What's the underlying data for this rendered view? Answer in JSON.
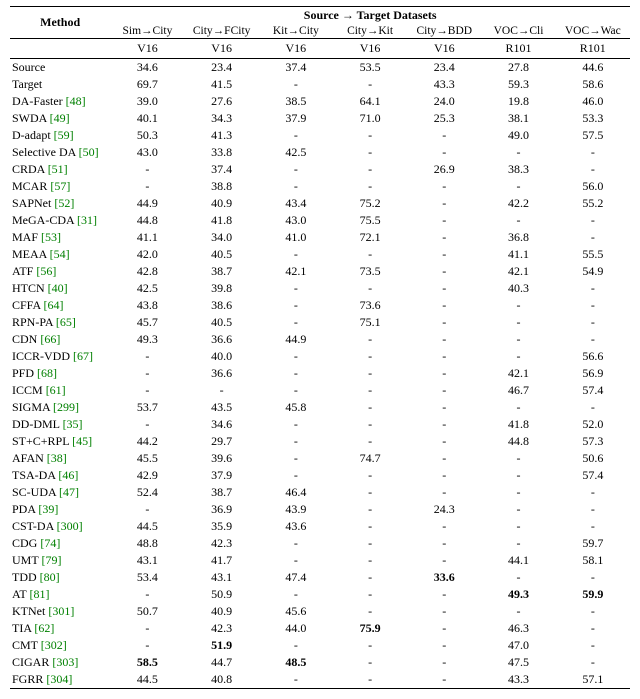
{
  "chart_data": {
    "type": "table",
    "title": "Source → Target Datasets",
    "method_header": "Method",
    "columns": [
      "Sim→City",
      "City→FCity",
      "Kit→City",
      "City→Kit",
      "City→BDD",
      "VOC→Cli",
      "VOC→Wac"
    ],
    "arch": [
      "V16",
      "V16",
      "V16",
      "V16",
      "V16",
      "R101",
      "R101"
    ],
    "rows": [
      {
        "name": "Source",
        "vals": [
          "34.6",
          "23.4",
          "37.4",
          "53.5",
          "23.4",
          "27.8",
          "44.6"
        ]
      },
      {
        "name": "Target",
        "vals": [
          "69.7",
          "41.5",
          "-",
          "-",
          "43.3",
          "59.3",
          "58.6"
        ]
      },
      {
        "name": "DA-Faster",
        "cite": "[48]",
        "vals": [
          "39.0",
          "27.6",
          "38.5",
          "64.1",
          "24.0",
          "19.8",
          "46.0"
        ]
      },
      {
        "name": "SWDA",
        "cite": "[49]",
        "vals": [
          "40.1",
          "34.3",
          "37.9",
          "71.0",
          "25.3",
          "38.1",
          "53.3"
        ]
      },
      {
        "name": "D-adapt",
        "cite": "[59]",
        "vals": [
          "50.3",
          "41.3",
          "-",
          "-",
          "-",
          "49.0",
          "57.5"
        ]
      },
      {
        "name": "Selective DA",
        "cite": "[50]",
        "vals": [
          "43.0",
          "33.8",
          "42.5",
          "-",
          "-",
          "-",
          "-"
        ]
      },
      {
        "name": "CRDA",
        "cite": "[51]",
        "vals": [
          "-",
          "37.4",
          "-",
          "-",
          "26.9",
          "38.3",
          "-"
        ]
      },
      {
        "name": "MCAR",
        "cite": "[57]",
        "vals": [
          "-",
          "38.8",
          "-",
          "-",
          "-",
          "-",
          "56.0"
        ]
      },
      {
        "name": "SAPNet",
        "cite": "[52]",
        "vals": [
          "44.9",
          "40.9",
          "43.4",
          "75.2",
          "-",
          "42.2",
          "55.2"
        ]
      },
      {
        "name": "MeGA-CDA",
        "cite": "[31]",
        "vals": [
          "44.8",
          "41.8",
          "43.0",
          "75.5",
          "-",
          "-",
          "-"
        ]
      },
      {
        "name": "MAF",
        "cite": "[53]",
        "vals": [
          "41.1",
          "34.0",
          "41.0",
          "72.1",
          "-",
          "36.8",
          "-"
        ]
      },
      {
        "name": "MEAA",
        "cite": "[54]",
        "vals": [
          "42.0",
          "40.5",
          "-",
          "-",
          "-",
          "41.1",
          "55.5"
        ]
      },
      {
        "name": "ATF",
        "cite": "[56]",
        "vals": [
          "42.8",
          "38.7",
          "42.1",
          "73.5",
          "-",
          "42.1",
          "54.9"
        ]
      },
      {
        "name": "HTCN",
        "cite": "[40]",
        "vals": [
          "42.5",
          "39.8",
          "-",
          "-",
          "-",
          "40.3",
          "-"
        ]
      },
      {
        "name": "CFFA",
        "cite": "[64]",
        "vals": [
          "43.8",
          "38.6",
          "-",
          "73.6",
          "-",
          "-",
          "-"
        ]
      },
      {
        "name": "RPN-PA",
        "cite": "[65]",
        "vals": [
          "45.7",
          "40.5",
          "-",
          "75.1",
          "-",
          "-",
          "-"
        ]
      },
      {
        "name": "CDN",
        "cite": "[66]",
        "vals": [
          "49.3",
          "36.6",
          "44.9",
          "-",
          "-",
          "-",
          "-"
        ]
      },
      {
        "name": "ICCR-VDD",
        "cite": "[67]",
        "vals": [
          "-",
          "40.0",
          "-",
          "-",
          "-",
          "-",
          "56.6"
        ]
      },
      {
        "name": "PFD",
        "cite": "[68]",
        "vals": [
          "-",
          "36.6",
          "-",
          "-",
          "-",
          "42.1",
          "56.9"
        ]
      },
      {
        "name": "ICCM",
        "cite": "[61]",
        "vals": [
          "-",
          "-",
          "-",
          "-",
          "-",
          "46.7",
          "57.4"
        ]
      },
      {
        "name": "SIGMA",
        "cite": "[299]",
        "vals": [
          "53.7",
          "43.5",
          "45.8",
          "-",
          "-",
          "-",
          "-"
        ]
      },
      {
        "name": "DD-DML",
        "cite": "[35]",
        "vals": [
          "-",
          "34.6",
          "-",
          "-",
          "-",
          "41.8",
          "52.0"
        ]
      },
      {
        "name": "ST+C+RPL",
        "cite": "[45]",
        "vals": [
          "44.2",
          "29.7",
          "-",
          "-",
          "-",
          "44.8",
          "57.3"
        ]
      },
      {
        "name": "AFAN",
        "cite": "[38]",
        "vals": [
          "45.5",
          "39.6",
          "-",
          "74.7",
          "-",
          "-",
          "50.6"
        ]
      },
      {
        "name": "TSA-DA",
        "cite": "[46]",
        "vals": [
          "42.9",
          "37.9",
          "-",
          "-",
          "-",
          "-",
          "57.4"
        ]
      },
      {
        "name": "SC-UDA",
        "cite": "[47]",
        "vals": [
          "52.4",
          "38.7",
          "46.4",
          "-",
          "-",
          "-",
          "-"
        ]
      },
      {
        "name": "PDA",
        "cite": "[39]",
        "vals": [
          "-",
          "36.9",
          "43.9",
          "-",
          "24.3",
          "-",
          "-"
        ]
      },
      {
        "name": "CST-DA",
        "cite": "[300]",
        "vals": [
          "44.5",
          "35.9",
          "43.6",
          "-",
          "-",
          "-",
          "-"
        ]
      },
      {
        "name": "CDG",
        "cite": "[74]",
        "vals": [
          "48.8",
          "42.3",
          "-",
          "-",
          "-",
          "-",
          "59.7"
        ]
      },
      {
        "name": "UMT",
        "cite": "[79]",
        "vals": [
          "43.1",
          "41.7",
          "-",
          "-",
          "-",
          "44.1",
          "58.1"
        ]
      },
      {
        "name": "TDD",
        "cite": "[80]",
        "vals": [
          "53.4",
          "43.1",
          "47.4",
          "-",
          "33.6",
          "-",
          "-"
        ],
        "bold": [
          4
        ]
      },
      {
        "name": "AT",
        "cite": "[81]",
        "vals": [
          "-",
          "50.9",
          "-",
          "-",
          "-",
          "49.3",
          "59.9"
        ],
        "bold": [
          5,
          6
        ]
      },
      {
        "name": "KTNet",
        "cite": "[301]",
        "vals": [
          "50.7",
          "40.9",
          "45.6",
          "-",
          "-",
          "-",
          "-"
        ]
      },
      {
        "name": "TIA",
        "cite": "[62]",
        "vals": [
          "-",
          "42.3",
          "44.0",
          "75.9",
          "-",
          "46.3",
          "-"
        ],
        "bold": [
          3
        ]
      },
      {
        "name": "CMT",
        "cite": "[302]",
        "vals": [
          "-",
          "51.9",
          "-",
          "-",
          "-",
          "47.0",
          "-"
        ],
        "bold": [
          1
        ]
      },
      {
        "name": "CIGAR",
        "cite": "[303]",
        "vals": [
          "58.5",
          "44.7",
          "48.5",
          "-",
          "-",
          "47.5",
          "-"
        ],
        "bold": [
          0,
          2
        ]
      },
      {
        "name": "FGRR",
        "cite": "[304]",
        "vals": [
          "44.5",
          "40.8",
          "-",
          "-",
          "-",
          "43.3",
          "57.1"
        ]
      }
    ]
  }
}
